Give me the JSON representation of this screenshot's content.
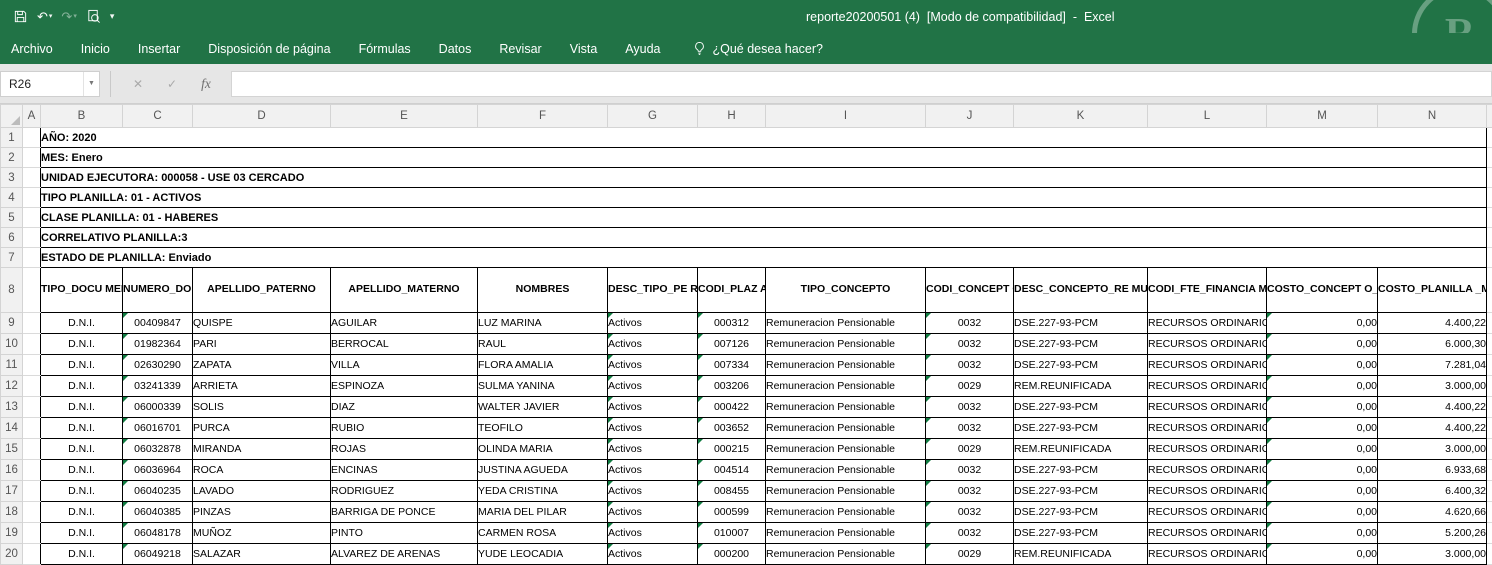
{
  "colors": {
    "titlebar_green": "#217346",
    "error_indicator_green": "#107c41",
    "table_border": "#000000"
  },
  "titlebar": {
    "title": "reporte20200501 (4)  [Modo de compatibilidad]  -  Excel",
    "qat_icons": [
      "save-icon",
      "undo-icon",
      "redo-icon",
      "print-preview-icon",
      "customize-qat-icon"
    ]
  },
  "menu": {
    "tabs": [
      "Archivo",
      "Inicio",
      "Insertar",
      "Disposición de página",
      "Fórmulas",
      "Datos",
      "Revisar",
      "Vista",
      "Ayuda"
    ],
    "search": "¿Qué desea hacer?"
  },
  "formula_bar": {
    "name_box": "R26",
    "cancel_icon": "✕",
    "enter_icon": "✓",
    "fx_icon": "fx",
    "formula_value": ""
  },
  "grid": {
    "columns": [
      "A",
      "B",
      "C",
      "D",
      "E",
      "F",
      "G",
      "H",
      "I",
      "J",
      "K",
      "L",
      "M",
      "N"
    ],
    "rows": [
      "1",
      "2",
      "3",
      "4",
      "5",
      "6",
      "7",
      "8",
      "9",
      "10",
      "11",
      "12",
      "13",
      "14",
      "15",
      "16",
      "17",
      "18",
      "19",
      "20"
    ]
  },
  "report": {
    "meta_rows": [
      "AÑO: 2020",
      "MES: Enero",
      "UNIDAD EJECUTORA: 000058 - USE 03 CERCADO",
      "TIPO PLANILLA: 01 - ACTIVOS",
      "CLASE PLANILLA: 01 - HABERES",
      "CORRELATIVO PLANILLA:3",
      "ESTADO DE PLANILLA: Enviado"
    ],
    "headers": [
      "TIPO_DOCU\nMENTO",
      "NUMERO_DO\nCUMENTO",
      "APELLIDO_PATERNO",
      "APELLIDO_MATERNO",
      "NOMBRES",
      "DESC_TIPO_PE\nRSONA",
      "CODI_PLAZ\nA",
      "TIPO_CONCEPTO",
      "CODI_CONCEPT\nO_REMUNERACI\nON",
      "DESC_CONCEPTO_RE\nMUNERACION",
      "CODI_FTE_FINANCIA\nMIENTO",
      "COSTO_CONCEPT\nO_PROGRAMADO",
      "COSTO_PLANILLA\n_MENSUAL"
    ],
    "rows": [
      [
        "D.N.I.",
        "00409847",
        "QUISPE",
        "AGUILAR",
        "LUZ MARINA",
        "Activos",
        "000312",
        "Remuneracion Pensionable",
        "0032",
        "DSE.227-93-PCM",
        "RECURSOS ORDINARIOS",
        "0,00",
        "4.400,22"
      ],
      [
        "D.N.I.",
        "01982364",
        "PARI",
        "BERROCAL",
        "RAUL",
        "Activos",
        "007126",
        "Remuneracion Pensionable",
        "0032",
        "DSE.227-93-PCM",
        "RECURSOS ORDINARIOS",
        "0,00",
        "6.000,30"
      ],
      [
        "D.N.I.",
        "02630290",
        "ZAPATA",
        "VILLA",
        "FLORA AMALIA",
        "Activos",
        "007334",
        "Remuneracion Pensionable",
        "0032",
        "DSE.227-93-PCM",
        "RECURSOS ORDINARIOS",
        "0,00",
        "7.281,04"
      ],
      [
        "D.N.I.",
        "03241339",
        "ARRIETA",
        "ESPINOZA",
        "SULMA YANINA",
        "Activos",
        "003206",
        "Remuneracion Pensionable",
        "0029",
        "REM.REUNIFICADA",
        "RECURSOS ORDINARIOS",
        "0,00",
        "3.000,00"
      ],
      [
        "D.N.I.",
        "06000339",
        "SOLIS",
        "DIAZ",
        "WALTER JAVIER",
        "Activos",
        "000422",
        "Remuneracion Pensionable",
        "0032",
        "DSE.227-93-PCM",
        "RECURSOS ORDINARIOS",
        "0,00",
        "4.400,22"
      ],
      [
        "D.N.I.",
        "06016701",
        "PURCA",
        "RUBIO",
        "TEOFILO",
        "Activos",
        "003652",
        "Remuneracion Pensionable",
        "0032",
        "DSE.227-93-PCM",
        "RECURSOS ORDINARIOS",
        "0,00",
        "4.400,22"
      ],
      [
        "D.N.I.",
        "06032878",
        "MIRANDA",
        "ROJAS",
        "OLINDA MARIA",
        "Activos",
        "000215",
        "Remuneracion Pensionable",
        "0029",
        "REM.REUNIFICADA",
        "RECURSOS ORDINARIOS",
        "0,00",
        "3.000,00"
      ],
      [
        "D.N.I.",
        "06036964",
        "ROCA",
        "ENCINAS",
        "JUSTINA AGUEDA",
        "Activos",
        "004514",
        "Remuneracion Pensionable",
        "0032",
        "DSE.227-93-PCM",
        "RECURSOS ORDINARIOS",
        "0,00",
        "6.933,68"
      ],
      [
        "D.N.I.",
        "06040235",
        "LAVADO",
        "RODRIGUEZ",
        "YEDA CRISTINA",
        "Activos",
        "008455",
        "Remuneracion Pensionable",
        "0032",
        "DSE.227-93-PCM",
        "RECURSOS ORDINARIOS",
        "0,00",
        "6.400,32"
      ],
      [
        "D.N.I.",
        "06040385",
        "PINZAS",
        "BARRIGA DE PONCE",
        "MARIA DEL PILAR",
        "Activos",
        "000599",
        "Remuneracion Pensionable",
        "0032",
        "DSE.227-93-PCM",
        "RECURSOS ORDINARIOS",
        "0,00",
        "4.620,66"
      ],
      [
        "D.N.I.",
        "06048178",
        "MUÑOZ",
        "PINTO",
        "CARMEN ROSA",
        "Activos",
        "010007",
        "Remuneracion Pensionable",
        "0032",
        "DSE.227-93-PCM",
        "RECURSOS ORDINARIOS",
        "0,00",
        "5.200,26"
      ],
      [
        "D.N.I.",
        "06049218",
        "SALAZAR",
        "ALVAREZ DE ARENAS",
        "YUDE LEOCADIA",
        "Activos",
        "000200",
        "Remuneracion Pensionable",
        "0029",
        "REM.REUNIFICADA",
        "RECURSOS ORDINARIOS",
        "0,00",
        "3.000,00"
      ]
    ]
  }
}
